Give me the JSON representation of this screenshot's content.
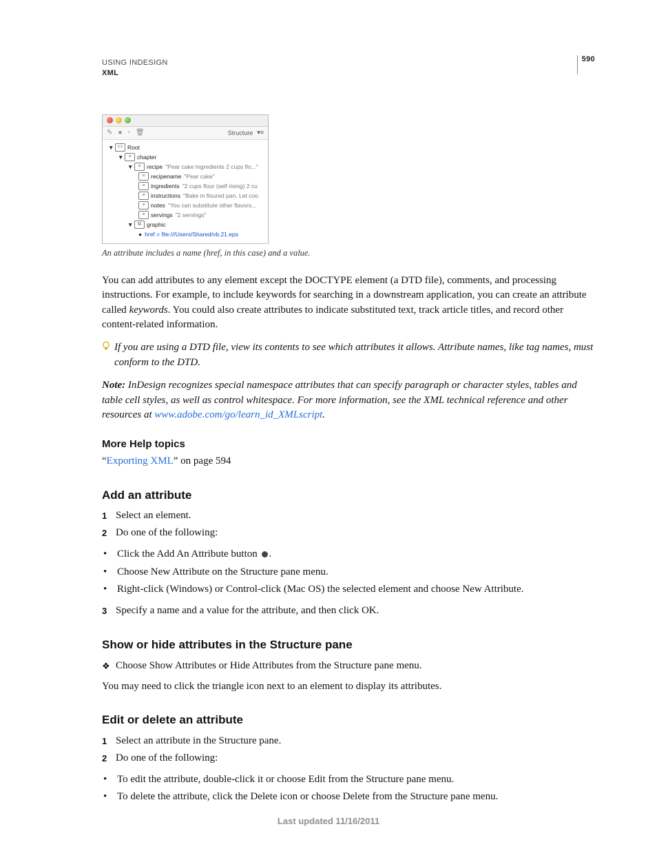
{
  "header": {
    "line1": "USING INDESIGN",
    "line2": "XML",
    "page_number": "590"
  },
  "figure": {
    "toolbar_label": "Structure",
    "tree": {
      "root": "Root",
      "chapter": "chapter",
      "recipe": {
        "label": "recipe",
        "snippet": "\"Pear cake Ingredients 2 cups flo...\""
      },
      "recipename": {
        "label": "recipename",
        "snippet": "\"Pear cake\""
      },
      "ingredients": {
        "label": "ingredients",
        "snippet": "\"2 cups flour (self rising) 2 cu"
      },
      "instructions": {
        "label": "instructions",
        "snippet": "\"Bake in floured pan. Let coo"
      },
      "notes": {
        "label": "notes",
        "snippet": "\"You can substitute other flavors..."
      },
      "servings": {
        "label": "servings",
        "snippet": "\"2 servings\""
      },
      "graphic": "graphic",
      "attr": "href = file:///Users/Shared/vb.21.eps"
    },
    "caption": "An attribute includes a name (href, in this case) and a value."
  },
  "paragraphs": {
    "p1a": "You can add attributes to any element except the DOCTYPE element (a DTD file), comments, and processing instructions. For example, to include keywords for searching in a downstream application, you can create an attribute called ",
    "p1_em": "keywords",
    "p1b": ". You could also create attributes to indicate substituted text, track article titles, and record other content-related information.",
    "tip": "If you are using a DTD file, view its contents to see which attributes it allows. Attribute names, like tag names, must conform to the DTD.",
    "note_label": "Note:",
    "note_body": " InDesign recognizes special namespace attributes that can specify paragraph or character styles, tables and table cell styles, as well as control whitespace. For more information, see the XML technical reference and other resources at ",
    "note_link": "www.adobe.com/go/learn_id_XMLscript",
    "note_end": "."
  },
  "more_help": {
    "heading": "More Help topics",
    "pre": "“",
    "link": "Exporting XML",
    "post": "” on page 594"
  },
  "sec_add": {
    "heading": "Add an attribute",
    "step1": "Select an element.",
    "step2": "Do one of the following:",
    "b1a": "Click the Add An Attribute button ",
    "b1b": ".",
    "b2": "Choose New Attribute on the Structure pane menu.",
    "b3": "Right-click (Windows) or Control-click (Mac OS) the selected element and choose New Attribute.",
    "step3": "Specify a name and a value for the attribute, and then click OK."
  },
  "sec_show": {
    "heading": "Show or hide attributes in the Structure pane",
    "b1": "Choose Show Attributes or Hide Attributes from the Structure pane menu.",
    "p": "You may need to click the triangle icon next to an element to display its attributes."
  },
  "sec_edit": {
    "heading": "Edit or delete an attribute",
    "step1": "Select an attribute in the Structure pane.",
    "step2": "Do one of the following:",
    "b1": "To edit the attribute, double-click it or choose Edit from the Structure pane menu.",
    "b2": "To delete the attribute, click the Delete icon or choose Delete from the Structure pane menu."
  },
  "footer": "Last updated 11/16/2011"
}
